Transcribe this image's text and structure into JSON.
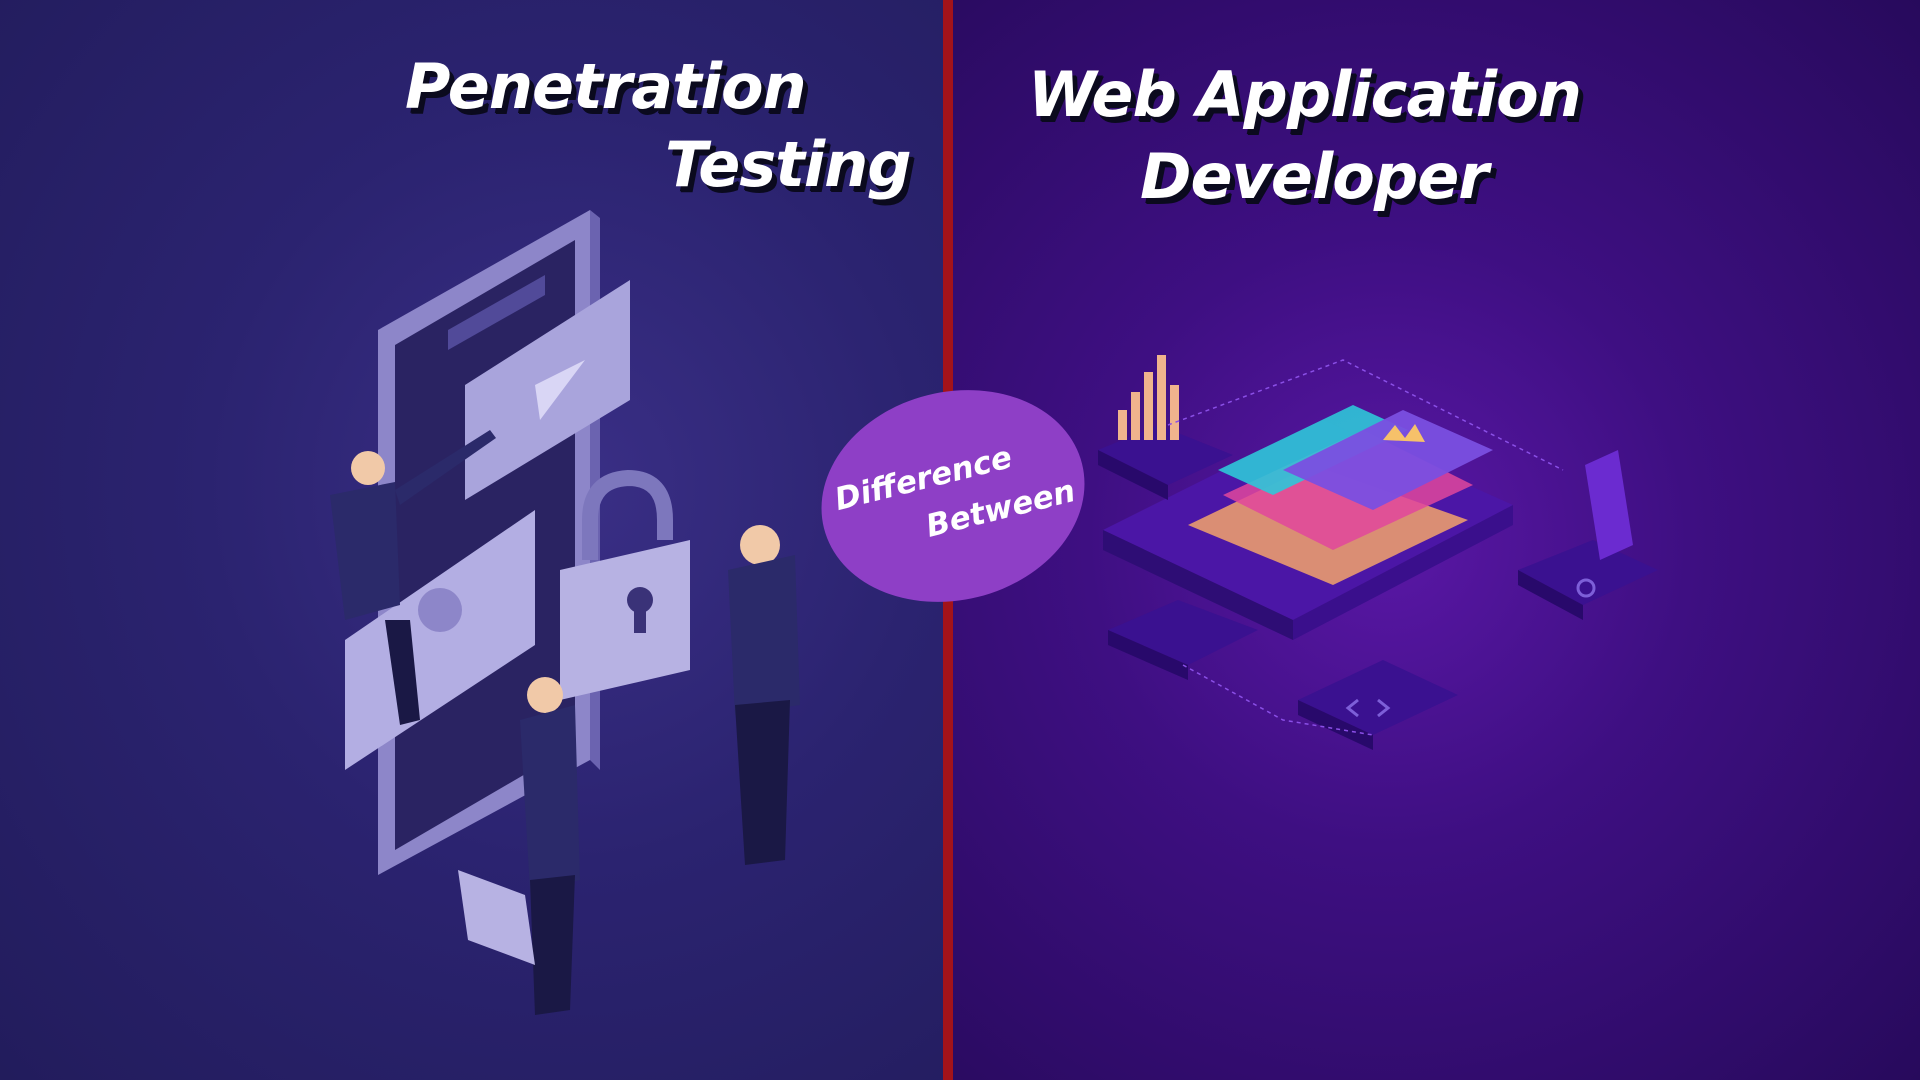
{
  "left_title": {
    "line1": "Penetration",
    "line2": "Testing"
  },
  "right_title": {
    "line1": "Web Application",
    "line2": "Developer"
  },
  "badge": {
    "line1": "Difference",
    "line2": "Between"
  },
  "colors": {
    "left_bg": "#2b2370",
    "right_bg": "#3e0f82",
    "divider": "#a3131a",
    "badge": "#8e3fc6"
  },
  "icons": [
    "smartphone-icon",
    "padlock-icon",
    "play-icon",
    "image-icon",
    "briefcase-icon",
    "person-figure",
    "isometric-platform",
    "bar-chart-icon",
    "crown-icon",
    "gear-icon",
    "code-icon"
  ]
}
